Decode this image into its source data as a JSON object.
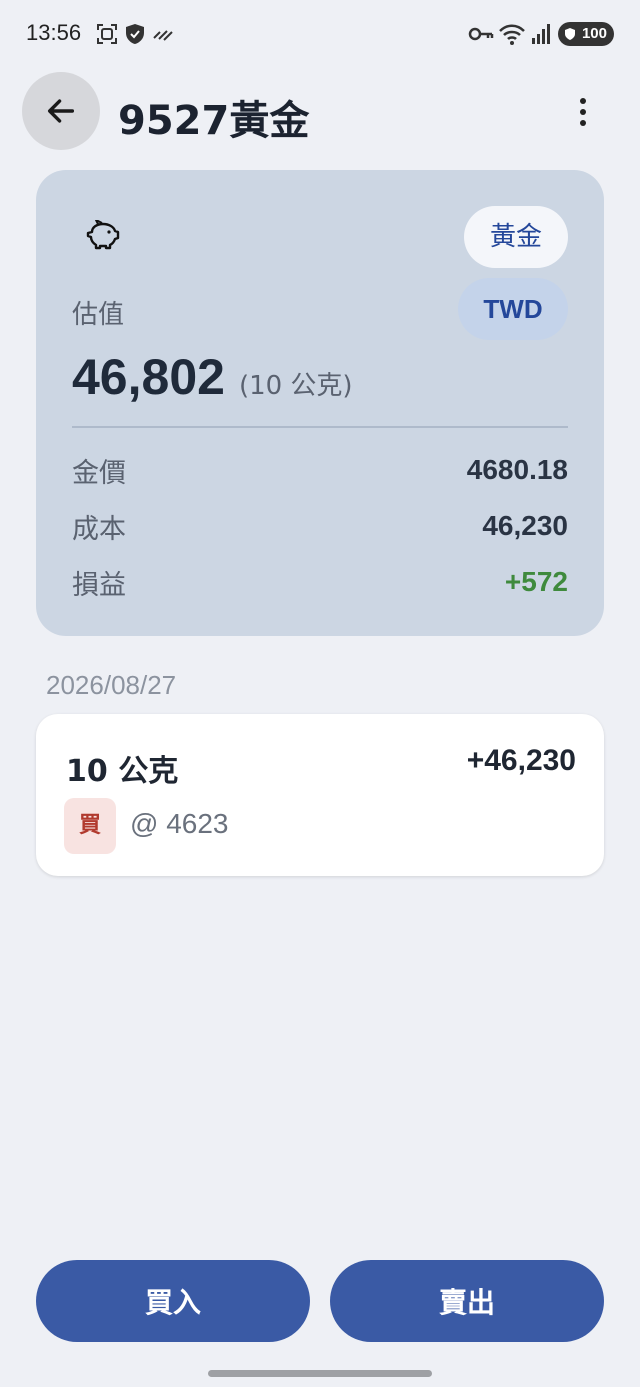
{
  "status_bar": {
    "time": "13:56",
    "battery": "100",
    "icons": [
      "screenshot-icon",
      "shield-icon",
      "data-saver-icon",
      "key-icon",
      "wifi-icon",
      "signal-icon"
    ]
  },
  "header": {
    "title": "9527黃金"
  },
  "summary": {
    "type_chip": "黃金",
    "currency_chip": "TWD",
    "valuation_label": "估值",
    "valuation_value": "46,802",
    "valuation_qty": "(10 公克)",
    "rows": [
      {
        "label": "金價",
        "value": "4680.18"
      },
      {
        "label": "成本",
        "value": "46,230"
      },
      {
        "label": "損益",
        "value": "+572"
      }
    ]
  },
  "transactions": {
    "date": "2026/08/27",
    "items": [
      {
        "qty": "10 公克",
        "amount": "+46,230",
        "badge": "買",
        "price": "@ 4623"
      }
    ]
  },
  "actions": {
    "buy_label": "買入",
    "sell_label": "賣出"
  },
  "colors": {
    "accent": "#3a5aa5",
    "card": "#ccd6e3",
    "positive": "#3f8a3d",
    "buy_badge": "#b13a2e"
  }
}
